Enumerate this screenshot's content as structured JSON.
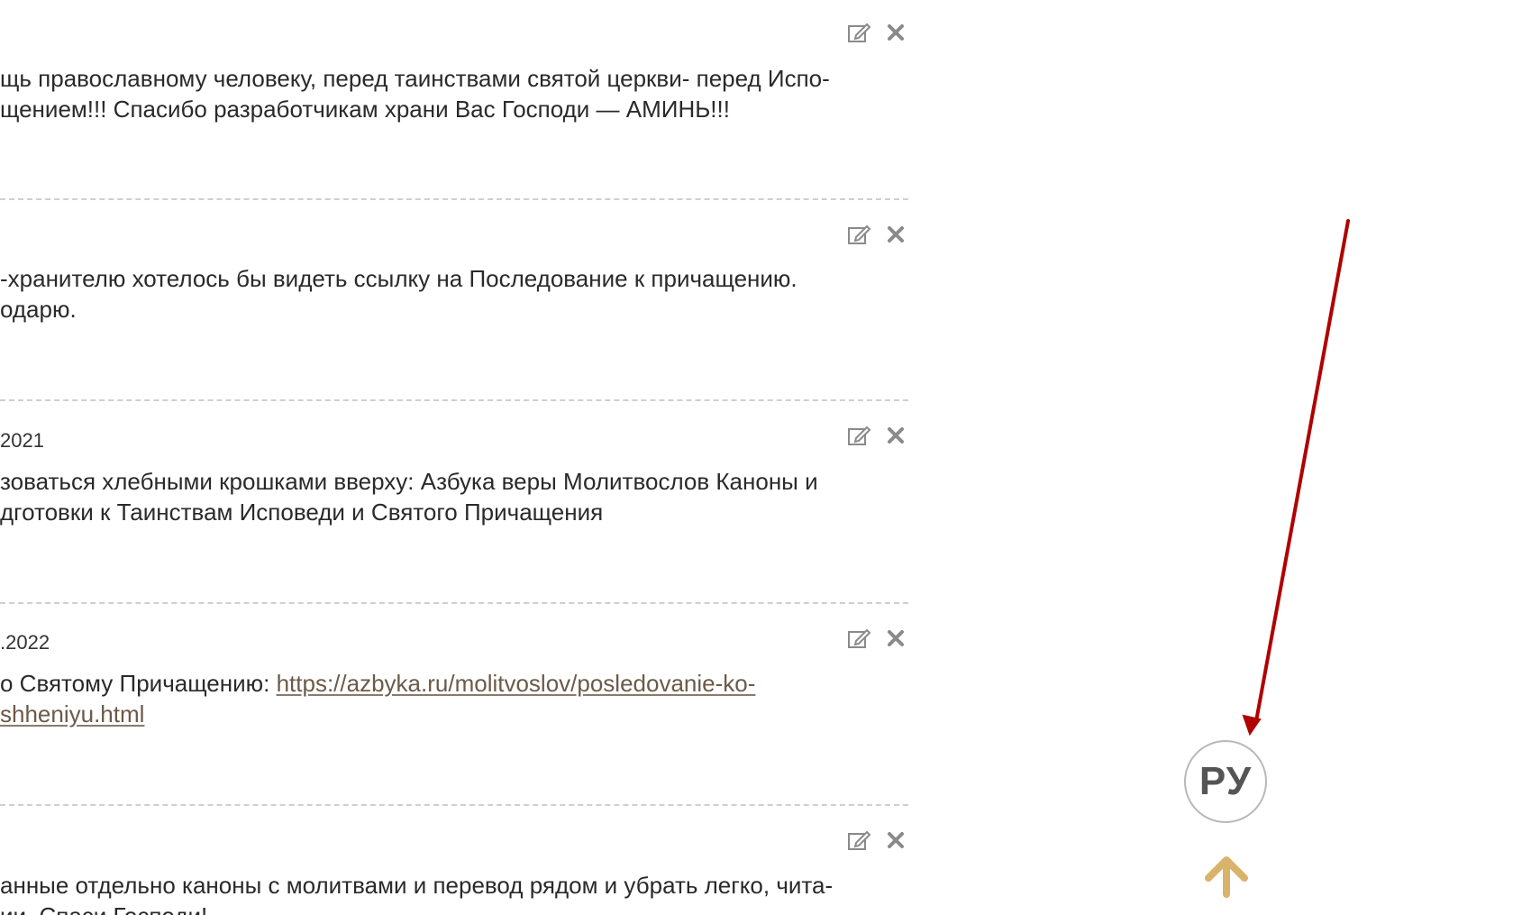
{
  "comments": [
    {
      "date": "",
      "lines": [
        "щь православному человеку, перед таинствами святой церкви- перед Испо-",
        "щением!!! Спасибо разработчикам храни Вас Господи — АМИНЬ!!!"
      ]
    },
    {
      "date": "",
      "lines": [
        "-хранителю хотелось бы видеть ссылку на Последование к причащению.",
        "одарю."
      ]
    },
    {
      "date": "2021",
      "lines": [
        "зоваться хлебными крошками вверху: Азбука веры Молитвослов Каноны и",
        "дготовки к Таинствам Исповеди и Святого Причащения"
      ]
    },
    {
      "date": ".2022",
      "line1_prefix": "о Святому Причащению: ",
      "line1_link": "https://azbyka.ru/molitvoslov/posledovanie-ko-",
      "line2_link": "shheniyu.html"
    },
    {
      "date": "",
      "lines": [
        "анные отдельно каноны с молитвами и перевод рядом и убрать легко, чита-",
        "ии. Спаси Господи!"
      ]
    }
  ],
  "icons": {
    "edit": "edit-icon",
    "delete": "close-icon",
    "scroll_top": "arrow-up-icon"
  },
  "language_button": {
    "label": "РУ"
  },
  "colors": {
    "annotation_arrow": "#b00000",
    "scroll_top_arrow": "#d9b36a",
    "link": "#6b5a49",
    "icon_gray": "#8a8a8a"
  }
}
